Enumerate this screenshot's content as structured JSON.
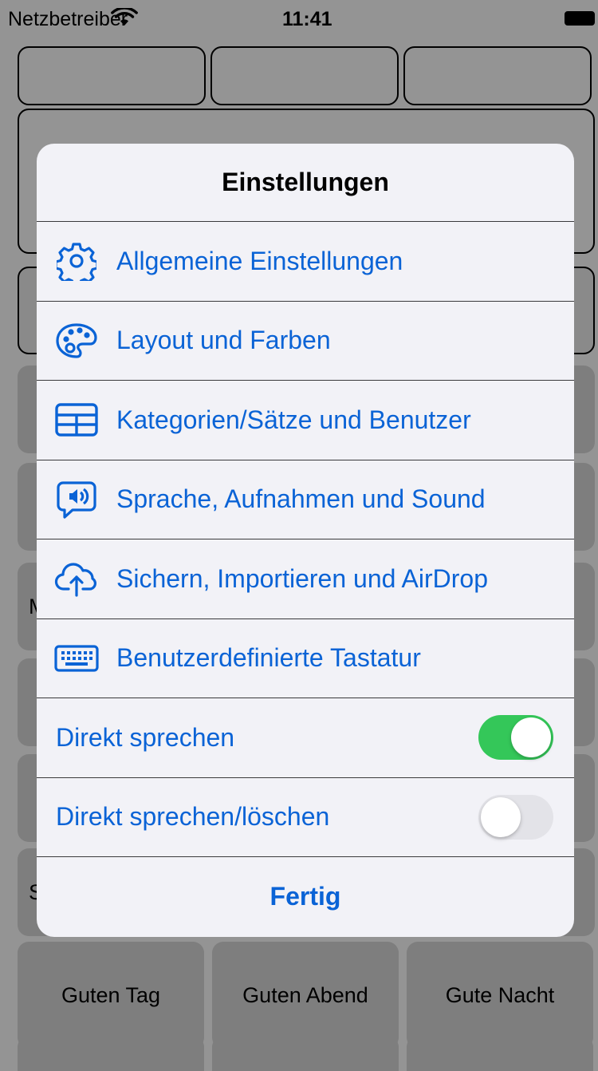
{
  "status_bar": {
    "carrier": "Netzbetreiber",
    "time": "11:41"
  },
  "background": {
    "edge_letters": [
      "M",
      "S"
    ],
    "phrase_buttons": [
      "Guten Tag",
      "Guten Abend",
      "Gute Nacht"
    ]
  },
  "settings": {
    "title": "Einstellungen",
    "menu": [
      {
        "icon": "gear-icon",
        "label": "Allgemeine Einstellungen"
      },
      {
        "icon": "palette-icon",
        "label": "Layout und Farben"
      },
      {
        "icon": "grid-table-icon",
        "label": "Kategorien/Sätze und Benutzer"
      },
      {
        "icon": "speaker-bubble-icon",
        "label": "Sprache, Aufnahmen und Sound"
      },
      {
        "icon": "cloud-upload-icon",
        "label": "Sichern, Importieren und AirDrop"
      },
      {
        "icon": "keyboard-icon",
        "label": "Benutzerdefinierte Tastatur"
      }
    ],
    "toggles": [
      {
        "label": "Direkt sprechen",
        "on": true
      },
      {
        "label": "Direkt sprechen/löschen",
        "on": false
      }
    ],
    "done_label": "Fertig"
  },
  "colors": {
    "accent": "#0a63d6",
    "switch_on": "#34c759",
    "sheet_bg": "#f2f2f7"
  }
}
